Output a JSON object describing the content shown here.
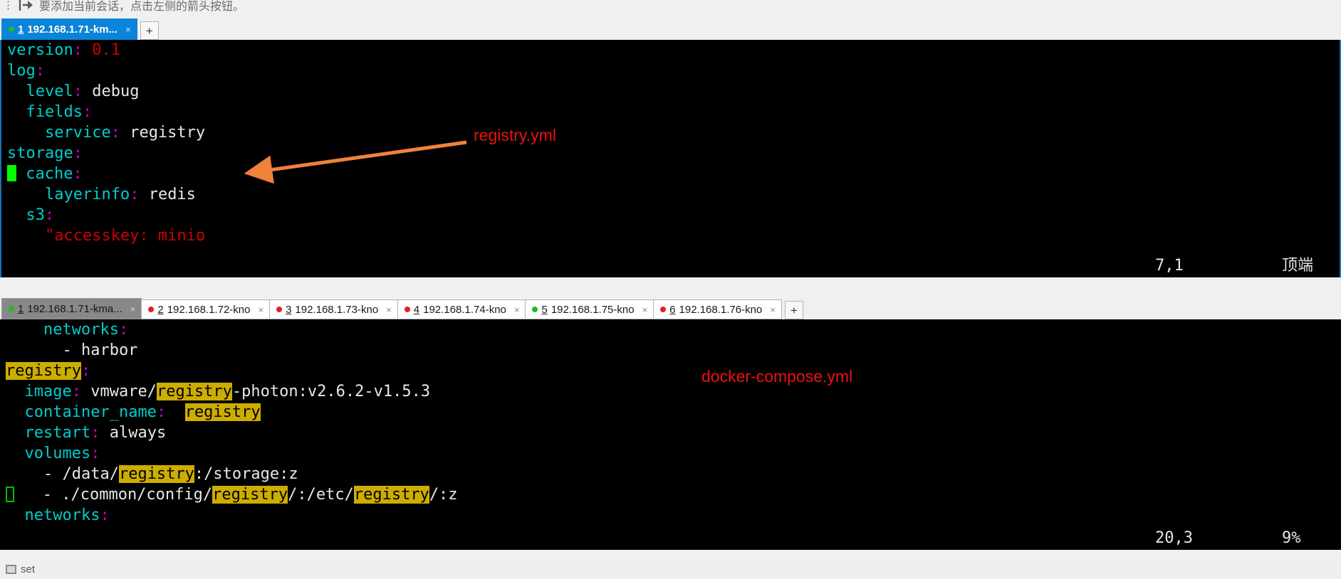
{
  "hint_bar": {
    "kebab_icon": "kebab-menu-icon",
    "arrow_icon": "arrow-into-box-icon",
    "text": "要添加当前会话，点击左侧的箭头按钮。"
  },
  "top_tabstrip": {
    "tabs": [
      {
        "dot": "green",
        "num": "1",
        "label": "192.168.1.71-km...",
        "close": "×",
        "active": true
      }
    ],
    "new_tab_label": "+"
  },
  "terminal_top": {
    "lines": [
      {
        "id": "line-1",
        "tokens": [
          {
            "t": "version",
            "cls": "k"
          },
          {
            "t": ":",
            "cls": "c"
          },
          {
            "t": " ",
            "cls": "v"
          },
          {
            "t": "0.1",
            "cls": "num"
          }
        ]
      },
      {
        "id": "line-2",
        "tokens": [
          {
            "t": "log",
            "cls": "k"
          },
          {
            "t": ":",
            "cls": "c"
          }
        ]
      },
      {
        "id": "line-3",
        "tokens": [
          {
            "t": "  ",
            "cls": "v"
          },
          {
            "t": "level",
            "cls": "k"
          },
          {
            "t": ":",
            "cls": "c"
          },
          {
            "t": " debug",
            "cls": "v"
          }
        ]
      },
      {
        "id": "line-4",
        "tokens": [
          {
            "t": "  ",
            "cls": "v"
          },
          {
            "t": "fields",
            "cls": "k"
          },
          {
            "t": ":",
            "cls": "c"
          }
        ]
      },
      {
        "id": "line-5",
        "tokens": [
          {
            "t": "    ",
            "cls": "v"
          },
          {
            "t": "service",
            "cls": "k"
          },
          {
            "t": ":",
            "cls": "c"
          },
          {
            "t": " registry",
            "cls": "v"
          }
        ]
      },
      {
        "id": "line-6",
        "tokens": [
          {
            "t": "storage",
            "cls": "k"
          },
          {
            "t": ":",
            "cls": "c"
          }
        ]
      },
      {
        "id": "line-7",
        "cursor": "block",
        "tokens": [
          {
            "t": " ",
            "cls": "v"
          },
          {
            "t": "cache",
            "cls": "k"
          },
          {
            "t": ":",
            "cls": "c"
          }
        ]
      },
      {
        "id": "line-8",
        "tokens": [
          {
            "t": "    ",
            "cls": "v"
          },
          {
            "t": "layerinfo",
            "cls": "k"
          },
          {
            "t": ":",
            "cls": "c"
          },
          {
            "t": " redis",
            "cls": "v"
          }
        ]
      },
      {
        "id": "line-9",
        "tokens": [
          {
            "t": "  ",
            "cls": "v"
          },
          {
            "t": "s3",
            "cls": "k"
          },
          {
            "t": ":",
            "cls": "c"
          }
        ]
      },
      {
        "id": "line-10",
        "tokens": [
          {
            "t": "    ",
            "cls": "v"
          },
          {
            "t": "\"accesskey: minio",
            "cls": "str"
          }
        ]
      }
    ],
    "ruler": {
      "position": "7,1",
      "percent": "顶端"
    }
  },
  "annotation_top": {
    "label": "registry.yml",
    "arrow_color": "#f0823c"
  },
  "bottom_tabstrip": {
    "tabs": [
      {
        "dot": "green",
        "num": "1",
        "label": "192.168.1.71-kma...",
        "close": "×",
        "active": true
      },
      {
        "dot": "red",
        "num": "2",
        "label": "192.168.1.72-kno",
        "close": "×",
        "active": false
      },
      {
        "dot": "red",
        "num": "3",
        "label": "192.168.1.73-kno",
        "close": "×",
        "active": false
      },
      {
        "dot": "red",
        "num": "4",
        "label": "192.168.1.74-kno",
        "close": "×",
        "active": false
      },
      {
        "dot": "green",
        "num": "5",
        "label": "192.168.1.75-kno",
        "close": "×",
        "active": false
      },
      {
        "dot": "red",
        "num": "6",
        "label": "192.168.1.76-kno",
        "close": "×",
        "active": false
      }
    ],
    "new_tab_label": "+"
  },
  "terminal_bottom": {
    "lines": [
      {
        "id": "bline-1",
        "tokens": [
          {
            "t": "    ",
            "cls": "v"
          },
          {
            "t": "networks",
            "cls": "k"
          },
          {
            "t": ":",
            "cls": "c"
          }
        ]
      },
      {
        "id": "bline-2",
        "tokens": [
          {
            "t": "      - harbor",
            "cls": "v"
          }
        ]
      },
      {
        "id": "bline-3",
        "tokens": [
          {
            "t": "registry",
            "cls": "hl"
          },
          {
            "t": ":",
            "cls": "c"
          }
        ]
      },
      {
        "id": "bline-4",
        "tokens": [
          {
            "t": "  ",
            "cls": "v"
          },
          {
            "t": "image",
            "cls": "k"
          },
          {
            "t": ":",
            "cls": "c"
          },
          {
            "t": " vmware/",
            "cls": "v"
          },
          {
            "t": "registry",
            "cls": "hl"
          },
          {
            "t": "-photon:v2.6.2-v1.5.3",
            "cls": "v"
          }
        ]
      },
      {
        "id": "bline-5",
        "tokens": [
          {
            "t": "  ",
            "cls": "v"
          },
          {
            "t": "container_name",
            "cls": "k"
          },
          {
            "t": ":",
            "cls": "c"
          },
          {
            "t": "  ",
            "cls": "v"
          },
          {
            "t": "registry",
            "cls": "hl"
          }
        ]
      },
      {
        "id": "bline-6",
        "tokens": [
          {
            "t": "  ",
            "cls": "v"
          },
          {
            "t": "restart",
            "cls": "k"
          },
          {
            "t": ":",
            "cls": "c"
          },
          {
            "t": " always",
            "cls": "v"
          }
        ]
      },
      {
        "id": "bline-7",
        "tokens": [
          {
            "t": "  ",
            "cls": "v"
          },
          {
            "t": "volumes",
            "cls": "k"
          },
          {
            "t": ":",
            "cls": "c"
          }
        ]
      },
      {
        "id": "bline-8",
        "tokens": [
          {
            "t": "    - /data/",
            "cls": "v"
          },
          {
            "t": "registry",
            "cls": "hl"
          },
          {
            "t": ":/storage:z",
            "cls": "v"
          }
        ]
      },
      {
        "id": "bline-9",
        "cursor": "hollow",
        "tokens": [
          {
            "t": "   - ./common/config/",
            "cls": "v"
          },
          {
            "t": "registry",
            "cls": "hl"
          },
          {
            "t": "/:/etc/",
            "cls": "v"
          },
          {
            "t": "registry",
            "cls": "hl"
          },
          {
            "t": "/:z",
            "cls": "v"
          }
        ]
      },
      {
        "id": "bline-10",
        "tokens": [
          {
            "t": "  ",
            "cls": "v"
          },
          {
            "t": "networks",
            "cls": "k"
          },
          {
            "t": ":",
            "cls": "c"
          }
        ]
      }
    ],
    "ruler": {
      "position": "20,3",
      "percent": "9%"
    }
  },
  "annotation_bottom": {
    "label": "docker-compose.yml",
    "arrow_color": "#f0823c"
  },
  "bottom_strip": {
    "item_label": "set",
    "icon": "window-box-icon"
  }
}
